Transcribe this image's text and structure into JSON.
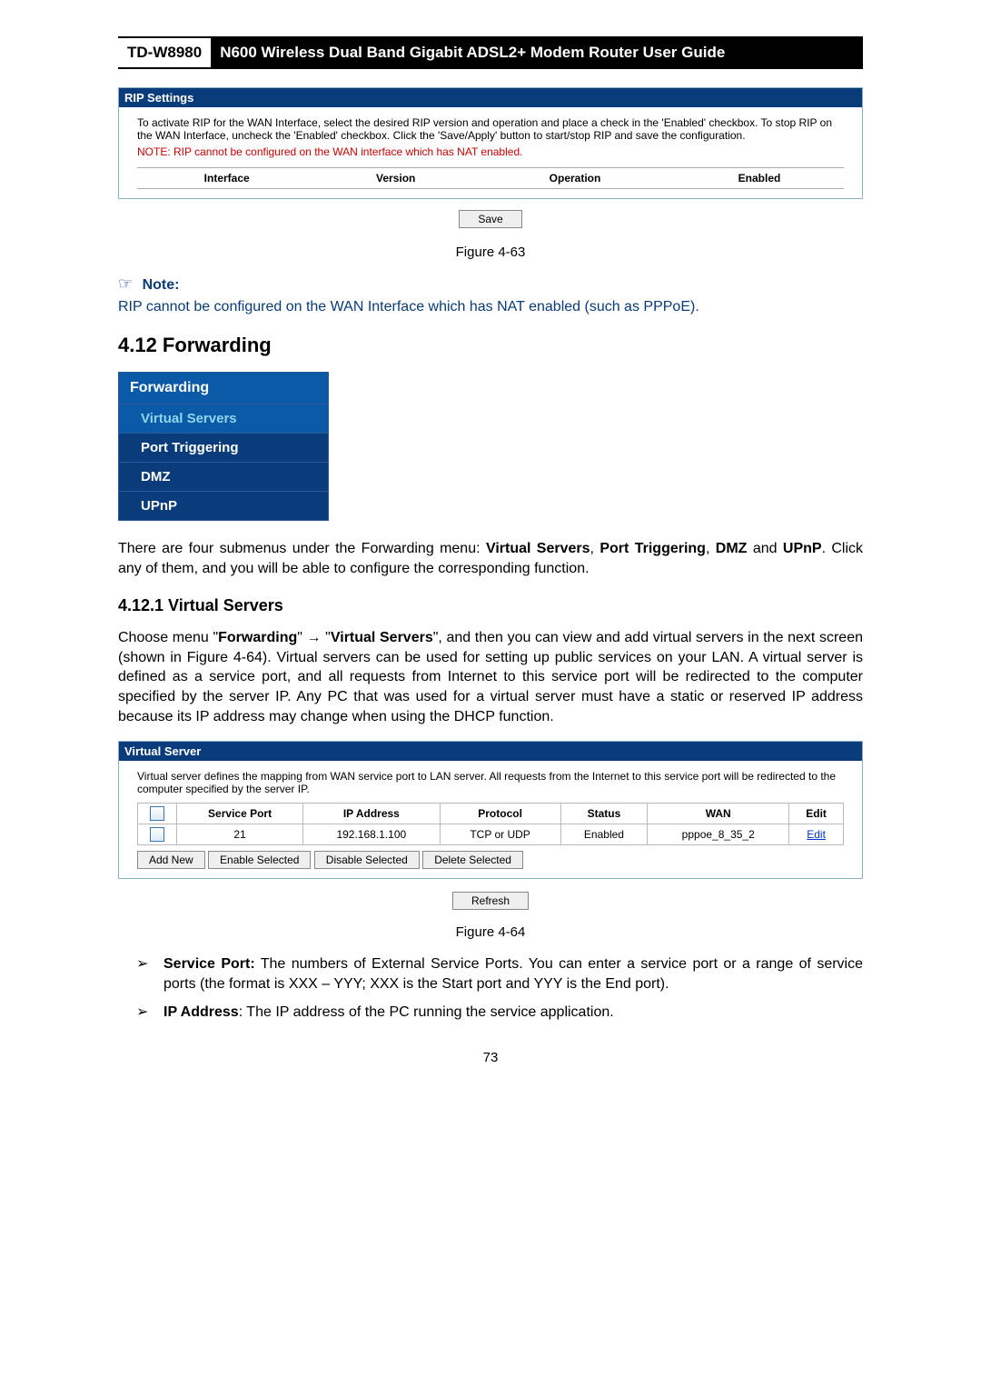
{
  "header": {
    "model": "TD-W8980",
    "title": "N600 Wireless Dual Band Gigabit ADSL2+ Modem Router User Guide"
  },
  "rip_panel": {
    "title": "RIP Settings",
    "desc": "To activate RIP for the WAN Interface, select the desired RIP version and operation and place a check in the 'Enabled' checkbox. To stop RIP on the WAN Interface, uncheck the 'Enabled' checkbox. Click the 'Save/Apply' button to start/stop RIP and save the configuration.",
    "note": "NOTE: RIP cannot be configured on the WAN interface which has NAT enabled.",
    "cols": {
      "interface": "Interface",
      "version": "Version",
      "operation": "Operation",
      "enabled": "Enabled"
    },
    "save": "Save"
  },
  "fig1": "Figure 4-63",
  "note": {
    "label": "Note:",
    "body": "RIP cannot be configured on the WAN Interface which has NAT enabled (such as PPPoE)."
  },
  "section": {
    "heading": "4.12  Forwarding"
  },
  "menu": {
    "head": "Forwarding",
    "items": [
      "Virtual Servers",
      "Port Triggering",
      "DMZ",
      "UPnP"
    ]
  },
  "para1_a": "There are four submenus under the Forwarding menu: ",
  "para1_b1": "Virtual Servers",
  "para1_c": ", ",
  "para1_b2": "Port Triggering",
  "para1_d": ", ",
  "para1_b3": "DMZ",
  "para1_e": " and ",
  "para1_b4": "UPnP",
  "para1_f": ". Click any of them, and you will be able to configure the corresponding function.",
  "subsection": "4.12.1 Virtual Servers",
  "para2_a": "Choose menu \"",
  "para2_b1": "Forwarding",
  "para2_c": "\" → \"",
  "para2_b2": "Virtual Servers",
  "para2_d": "\", and then you can view and add virtual servers in the next screen (shown in Figure 4-64). Virtual servers can be used for setting up public services on your LAN. A virtual server is defined as a service port, and all requests from Internet to this service port will be redirected to the computer specified by the server IP. Any PC that was used for a virtual server must have a static or reserved IP address because its IP address may change when using the DHCP function.",
  "vs_panel": {
    "title": "Virtual Server",
    "desc": "Virtual server defines the mapping from WAN service port to LAN server. All requests from the Internet to this service port will be redirected to the computer specified by the server IP.",
    "cols": {
      "service_port": "Service Port",
      "ip": "IP Address",
      "protocol": "Protocol",
      "status": "Status",
      "wan": "WAN",
      "edit": "Edit"
    },
    "row": {
      "service_port": "21",
      "ip": "192.168.1.100",
      "protocol": "TCP or UDP",
      "status": "Enabled",
      "wan": "pppoe_8_35_2",
      "edit": "Edit"
    },
    "buttons": {
      "add": "Add New",
      "enable": "Enable Selected",
      "disable": "Disable Selected",
      "delete": "Delete Selected",
      "refresh": "Refresh"
    }
  },
  "fig2": "Figure 4-64",
  "bullets": {
    "b1_label": "Service Port:",
    "b1_text": " The numbers of External Service Ports. You can enter a service port or a range of service ports (the format is XXX – YYY; XXX is the Start port and YYY is the End port).",
    "b2_label": "IP Address",
    "b2_text": ": The IP address of the PC running the service application."
  },
  "page_num": "73"
}
